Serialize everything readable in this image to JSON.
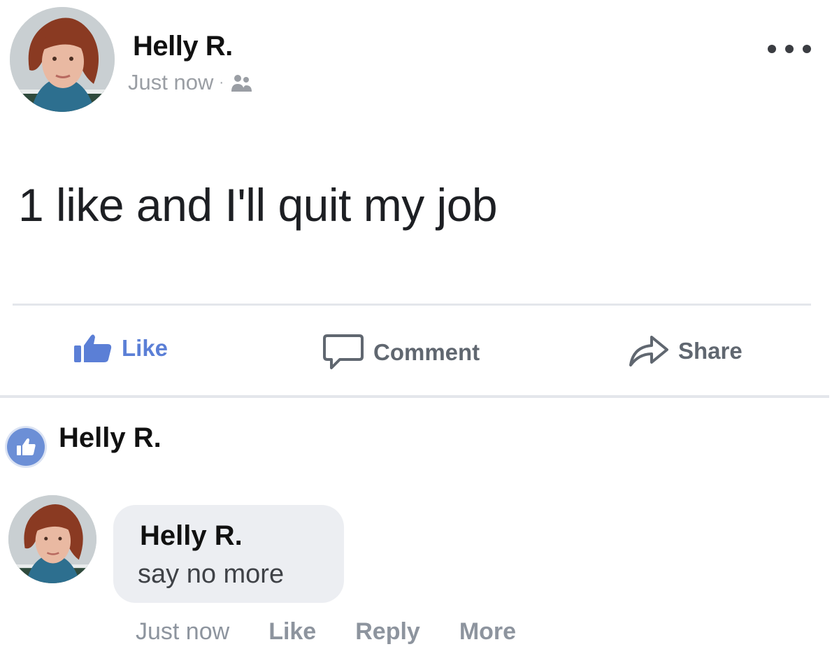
{
  "post": {
    "author": "Helly R.",
    "timestamp": "Just now",
    "separator": "·",
    "audience_icon": "friends-icon",
    "text": "1 like and I'll quit my job",
    "menu_icon": "more-horizontal-icon"
  },
  "actions": {
    "like": "Like",
    "comment": "Comment",
    "share": "Share"
  },
  "reactions": {
    "icon": "like-badge-icon",
    "name": "Helly R."
  },
  "comment": {
    "author": "Helly R.",
    "text": "say no more",
    "timestamp": "Just now",
    "like": "Like",
    "reply": "Reply",
    "more": "More"
  },
  "colors": {
    "like_blue": "#5b7fd6",
    "meta_gray": "#9a9ea4",
    "bubble_gray": "#eceef2"
  }
}
